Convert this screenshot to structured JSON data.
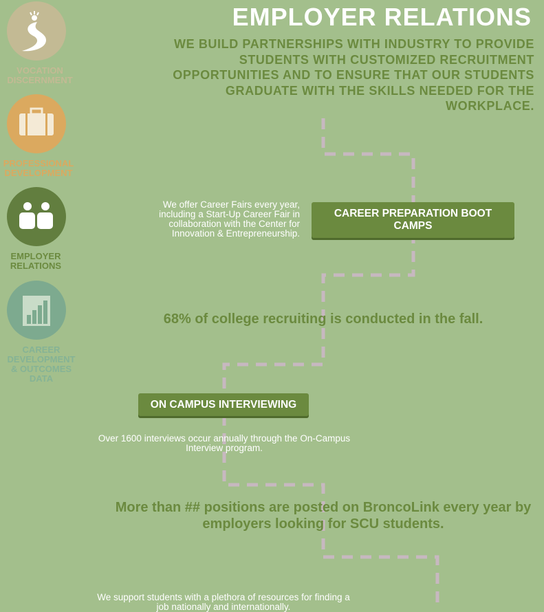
{
  "sidebar": {
    "items": [
      {
        "label": "VOCATION\nDISCERNMENT",
        "icon": "road-lightbulb-icon"
      },
      {
        "label": "PROFESSIONAL\nDEVELOPMENT",
        "icon": "briefcase-icon"
      },
      {
        "label": "EMPLOYER\nRELATIONS",
        "icon": "people-icon"
      },
      {
        "label": "CAREER\nDEVELOPMENT\n& OUTCOMES\nDATA",
        "icon": "bar-chart-icon"
      }
    ]
  },
  "header": {
    "title": "EMPLOYER RELATIONS",
    "intro": "WE BUILD PARTNERSHIPS WITH INDUSTRY TO PROVIDE STUDENTS WITH CUSTOMIZED RECRUITMENT OPPORTUNITIES AND TO ENSURE THAT OUR STUDENTS GRADUATE WITH THE SKILLS NEEDED FOR THE WORKPLACE."
  },
  "content": {
    "career_fairs_text": "We offer Career Fairs every year, including a Start-Up Career Fair in collaboration with the Center for Innovation & Entrepreneurship.",
    "boot_camps_button": "CAREER PREPARATION BOOT CAMPS",
    "fall_stat": "68% of college recruiting is conducted in the fall.",
    "on_campus_button": "ON CAMPUS INTERVIEWING",
    "interviews_text": "Over 1600 interviews occur annually through the On-Campus Interview program.",
    "positions_stat": "More than ## positions are posted on BroncoLink every year by employers looking for SCU students.",
    "resources_text": "We support students with a plethora of resources for finding a job nationally and internationally."
  },
  "colors": {
    "background": "#a3bf8c",
    "accent_green": "#6b8a3f",
    "dash": "#c7b8c0"
  }
}
